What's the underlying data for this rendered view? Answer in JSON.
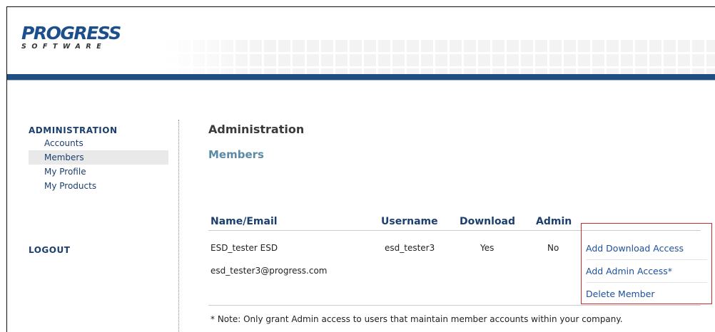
{
  "header": {
    "logo_main": "PROGRESS",
    "logo_sub": "SOFTWARE",
    "brand_color": "#1f4f80"
  },
  "sidebar": {
    "heading": "ADMINISTRATION",
    "items": [
      {
        "label": "Accounts",
        "active": false
      },
      {
        "label": "Members",
        "active": true
      },
      {
        "label": "My Profile",
        "active": false
      },
      {
        "label": "My Products",
        "active": false
      }
    ],
    "logout": "LOGOUT"
  },
  "main": {
    "title": "Administration",
    "subtitle": "Members",
    "table": {
      "columns": [
        "Name/Email",
        "Username",
        "Download",
        "Admin"
      ],
      "rows": [
        {
          "name": "ESD_tester ESD",
          "email": "esd_tester3@progress.com",
          "username": "esd_tester3",
          "download": "Yes",
          "admin": "No"
        }
      ]
    },
    "actions": [
      "Add Download Access",
      "Add Admin Access*",
      "Delete Member"
    ],
    "note": "* Note: Only grant Admin access to users that maintain member accounts within your company."
  }
}
